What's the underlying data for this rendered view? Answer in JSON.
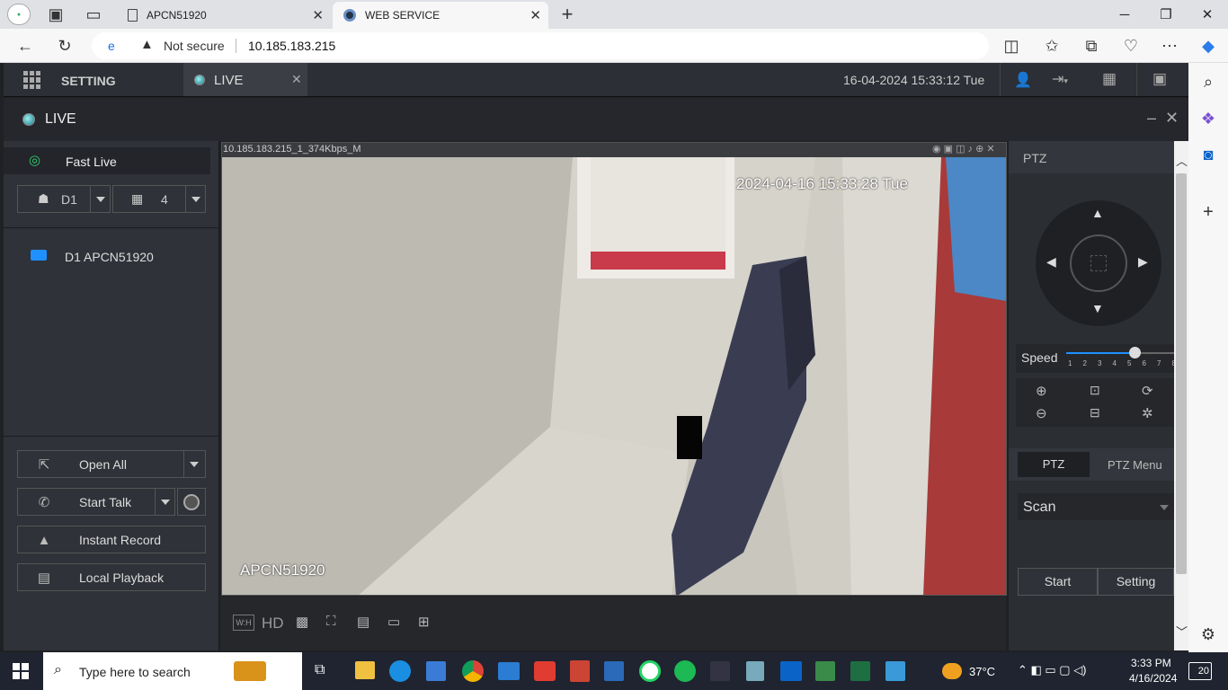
{
  "browser": {
    "tabs": [
      {
        "title": "APCN51920",
        "active": false
      },
      {
        "title": "WEB SERVICE",
        "active": true
      }
    ],
    "security": "Not secure",
    "url": "10.185.183.215"
  },
  "app": {
    "setting_label": "SETTING",
    "live_tab_label": "LIVE",
    "datetime": "16-04-2024 15:33:12 Tue",
    "panel_title": "LIVE"
  },
  "sidebar": {
    "fast_live": "Fast Live",
    "stream_select": "D1",
    "split_select": "4",
    "device": "D1 APCN51920",
    "buttons": {
      "open_all": "Open All",
      "start_talk": "Start Talk",
      "instant_record": "Instant Record",
      "local_playback": "Local Playback"
    }
  },
  "video": {
    "stream_info": "10.185.183.215_1_374Kbps_M",
    "osd_time": "2024-04-16 15:33:28 Tue",
    "osd_name": "APCN51920",
    "toolbar": {
      "wh": "W:H",
      "hd": "HD"
    }
  },
  "ptz": {
    "title": "PTZ",
    "speed_label": "Speed",
    "speed_ticks": [
      "1",
      "2",
      "3",
      "4",
      "5",
      "6",
      "7",
      "8"
    ],
    "speed_value": 5,
    "tab_ptz": "PTZ",
    "tab_menu": "PTZ Menu",
    "mode": "Scan",
    "start": "Start",
    "setting": "Setting"
  },
  "taskbar": {
    "search_placeholder": "Type here to search",
    "weather": "37°C",
    "time": "3:33 PM",
    "date": "4/16/2024",
    "notifications": "20"
  },
  "colors": {
    "accent": "#1e90ff",
    "panel": "#2f3238",
    "live_dot": "#2aa6a0"
  }
}
